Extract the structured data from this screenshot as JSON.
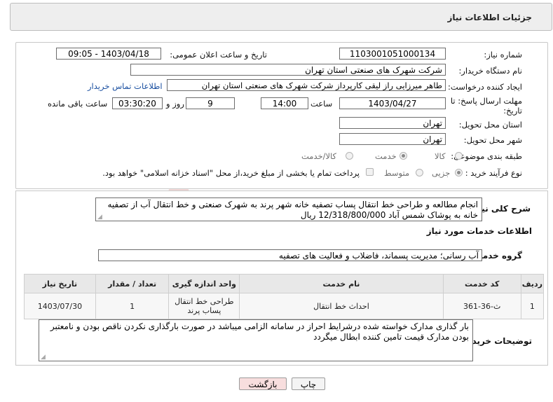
{
  "header": {
    "title": "جزئیات اطلاعات نیاز"
  },
  "form": {
    "need_number_label": "شماره نیاز:",
    "need_number": "1103001051000134",
    "announce_label": "تاریخ و ساعت اعلان عمومی:",
    "announce_value": "1403/04/18 - 09:05",
    "buyer_org_label": "نام دستگاه خریدار:",
    "buyer_org": "شرکت شهرک های صنعتی استان تهران",
    "creator_label": "ایجاد کننده درخواست:",
    "creator": "طاهر  میرزایی راز لیقی کارپرداز شرکت شهرک های صنعتی استان تهران",
    "contact_link": "اطلاعات تماس خریدار",
    "deadline_label_1": "مهلت ارسال پاسخ: تا",
    "deadline_label_2": "تاریخ:",
    "deadline_date": "1403/04/27",
    "time_label": "ساعت",
    "deadline_time": "14:00",
    "days": "9",
    "days_label": "روز و",
    "remaining": "03:30:20",
    "remaining_label": "ساعت باقی مانده",
    "province_label": "استان محل تحویل:",
    "province": "تهران",
    "city_label": "شهر محل تحویل:",
    "city": "تهران",
    "category_label": "طبقه بندی موضوعی:",
    "category_options": [
      "کالا",
      "خدمت",
      "کالا/خدمت"
    ],
    "category_selected": "خدمت",
    "process_label": "نوع فرآیند خرید :",
    "process_options": [
      "جزیی",
      "متوسط"
    ],
    "process_selected": "جزیی",
    "payment_note": "پرداخت تمام یا بخشی از مبلغ خرید،از محل \"اسناد خزانه اسلامی\" خواهد بود."
  },
  "summary": {
    "label": "شرح کلی نیاز:",
    "text": "انجام مطالعه و طراحی خط انتقال پساب تصفیه خانه شهر پرند به شهرک صنعتی و خط انتقال آب از تصفیه خانه به پوشاک شمس آباد 12/318/800/000 ریال"
  },
  "services": {
    "section_title": "اطلاعات خدمات مورد نیاز",
    "group_label": "گروه خدمت:",
    "group_value": "آب رسانی؛ مدیریت پسماند، فاضلاب و فعالیت های تصفیه",
    "table": {
      "headers": [
        "ردیف",
        "کد خدمت",
        "نام خدمت",
        "واحد اندازه گیری",
        "تعداد / مقدار",
        "تاریخ نیاز"
      ],
      "rows": [
        [
          "1",
          "ث-36-361",
          "احداث خط انتقال",
          "طراحی خط انتقال پساب پرند",
          "1",
          "1403/07/30"
        ]
      ]
    }
  },
  "buyer_notes": {
    "label": "توضیحات خریدار:",
    "text": "بار گذاری مدارک خواسته شده درشرایط احراز در سامانه الزامی میباشد  در صورت بارگذاری نکردن ناقص بودن و نامعتبر بودن مدارک قیمت تامین کننده ابطال میگردد"
  },
  "buttons": {
    "print": "چاپ",
    "back": "بازگشت"
  },
  "colors": {
    "back_button_bg": "#f8dede",
    "link": "#1a4fa0"
  }
}
